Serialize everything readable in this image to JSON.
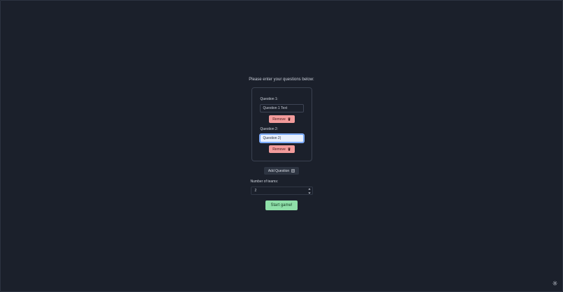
{
  "prompt": "Please enter your questions below:",
  "questions": [
    {
      "label": "Question 1:",
      "value": "Question 1 Text"
    },
    {
      "label": "Question 2:",
      "value": "Question 2|"
    }
  ],
  "remove_label": "Remove",
  "add_question_label": "Add Question",
  "teams": {
    "label": "Number of teams:",
    "value": "2"
  },
  "start_label": "Start game!",
  "colors": {
    "background": "#1b202b",
    "remove": "#f29b9b",
    "start": "#8fe0a9",
    "focus": "#6aa0ff"
  },
  "icons": {
    "remove": "trash-icon",
    "add": "plus-square-icon",
    "theme": "sun-icon",
    "stepper": "chevron-up-down-icon"
  }
}
